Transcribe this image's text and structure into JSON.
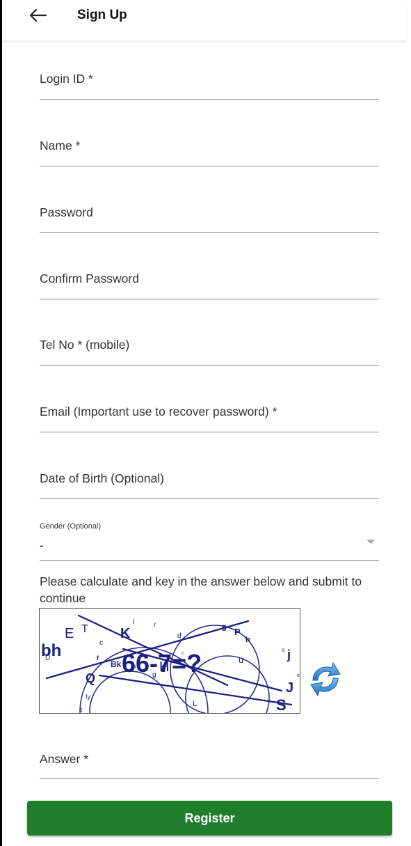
{
  "header": {
    "title": "Sign Up",
    "back_icon": "arrow-left-icon"
  },
  "form": {
    "fields": [
      {
        "label": "Login ID *"
      },
      {
        "label": "Name *"
      },
      {
        "label": "Password"
      },
      {
        "label": "Confirm Password"
      },
      {
        "label": "Tel No * (mobile)"
      },
      {
        "label": "Email (Important use to recover password) *"
      },
      {
        "label": "Date of Birth (Optional)"
      }
    ],
    "gender": {
      "label": "Gender (Optional)",
      "value": "-"
    },
    "captcha": {
      "instruction": "Please calculate and key in the answer below and submit to continue",
      "equation": "66-7=?",
      "refresh_icon": "refresh-icon"
    },
    "answer": {
      "label": "Answer *"
    },
    "register_label": "Register"
  },
  "colors": {
    "primary_button": "#1e7e2c",
    "captcha_text": "#1a1f8a",
    "refresh_icon": "#2a7fc9"
  }
}
